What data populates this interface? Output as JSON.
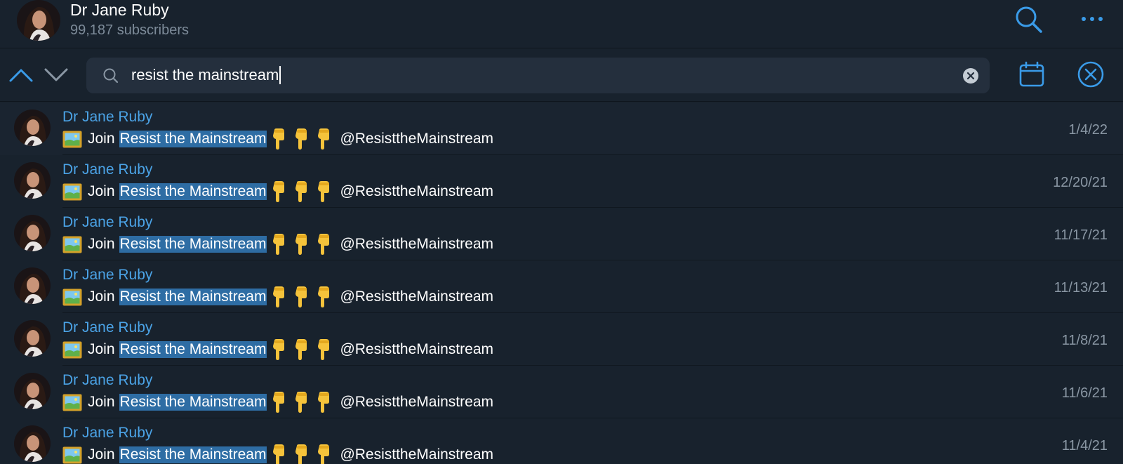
{
  "channel": {
    "title": "Dr Jane Ruby",
    "subtitle": "99,187 subscribers"
  },
  "search": {
    "query": "resist the mainstream"
  },
  "icons": {
    "header_search": "search-icon",
    "header_more": "more-icon",
    "nav_up": "chevron-up-icon",
    "nav_down": "chevron-down-icon",
    "field_search": "magnifier-icon",
    "field_clear": "clear-icon",
    "calendar": "calendar-icon",
    "close": "close-circle-icon"
  },
  "colors": {
    "accent": "#3a9be8",
    "highlight": "#2e6da4",
    "sender": "#4ba3e6"
  },
  "results": [
    {
      "sender": "Dr Jane Ruby",
      "prefix": "Join",
      "highlight": "Resist the Mainstream",
      "mention": "@ResisttheMainstream",
      "date": "1/4/22"
    },
    {
      "sender": "Dr Jane Ruby",
      "prefix": "Join",
      "highlight": "Resist the Mainstream",
      "mention": "@ResisttheMainstream",
      "date": "12/20/21"
    },
    {
      "sender": "Dr Jane Ruby",
      "prefix": "Join",
      "highlight": "Resist the Mainstream",
      "mention": "@ResisttheMainstream",
      "date": "11/17/21"
    },
    {
      "sender": "Dr Jane Ruby",
      "prefix": "Join",
      "highlight": "Resist the Mainstream",
      "mention": "@ResisttheMainstream",
      "date": "11/13/21"
    },
    {
      "sender": "Dr Jane Ruby",
      "prefix": "Join",
      "highlight": "Resist the Mainstream",
      "mention": "@ResisttheMainstream",
      "date": "11/8/21"
    },
    {
      "sender": "Dr Jane Ruby",
      "prefix": "Join",
      "highlight": "Resist the Mainstream",
      "mention": "@ResisttheMainstream",
      "date": "11/6/21"
    },
    {
      "sender": "Dr Jane Ruby",
      "prefix": "Join",
      "highlight": "Resist the Mainstream",
      "mention": "@ResisttheMainstream",
      "date": "11/4/21"
    }
  ]
}
